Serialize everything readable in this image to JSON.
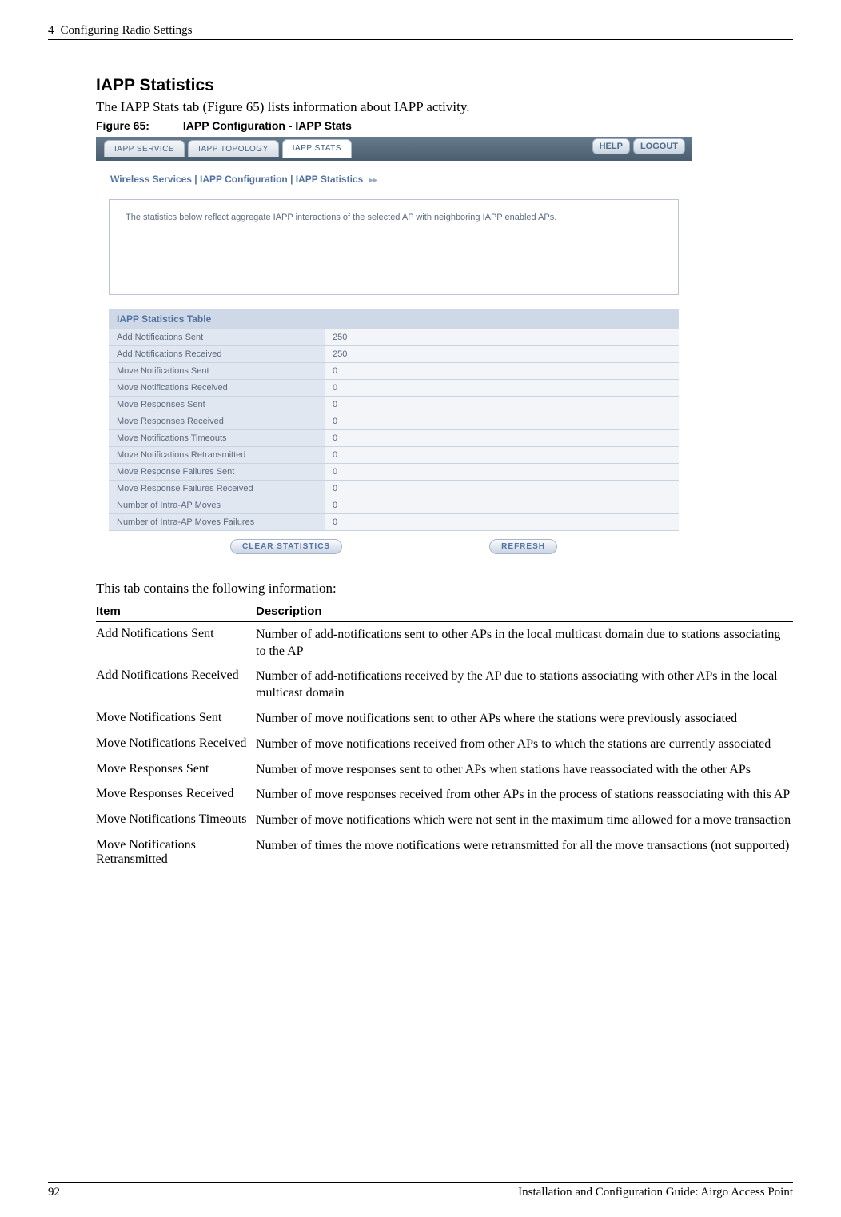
{
  "header": {
    "chapter_num": "4",
    "chapter_title": "Configuring Radio Settings"
  },
  "section": {
    "title": "IAPP Statistics",
    "intro": "The IAPP Stats tab (Figure 65) lists information about IAPP activity.",
    "figure_num": "Figure 65:",
    "figure_title": "IAPP Configuration - IAPP Stats",
    "after_figure": "This tab contains the following information:"
  },
  "screenshot": {
    "tabs": [
      "IAPP SERVICE",
      "IAPP TOPOLOGY",
      "IAPP STATS"
    ],
    "help": "HELP",
    "logout": "LOGOUT",
    "breadcrumb": "Wireless Services | IAPP Configuration | IAPP Statistics",
    "info_text": "The statistics below reflect aggregate IAPP interactions of the selected AP with neighboring IAPP enabled APs.",
    "table_title": "IAPP Statistics Table",
    "rows": [
      {
        "label": "Add Notifications Sent",
        "value": "250"
      },
      {
        "label": "Add Notifications Received",
        "value": "250"
      },
      {
        "label": "Move Notifications Sent",
        "value": "0"
      },
      {
        "label": "Move Notifications Received",
        "value": "0"
      },
      {
        "label": "Move Responses Sent",
        "value": "0"
      },
      {
        "label": "Move Responses Received",
        "value": "0"
      },
      {
        "label": "Move Notifications Timeouts",
        "value": "0"
      },
      {
        "label": "Move Notifications Retransmitted",
        "value": "0"
      },
      {
        "label": "Move Response Failures Sent",
        "value": "0"
      },
      {
        "label": "Move Response Failures Received",
        "value": "0"
      },
      {
        "label": "Number of Intra-AP Moves",
        "value": "0"
      },
      {
        "label": "Number of Intra-AP Moves Failures",
        "value": "0"
      }
    ],
    "btn_clear": "CLEAR STATISTICS",
    "btn_refresh": "REFRESH"
  },
  "desc_table": {
    "h_item": "Item",
    "h_desc": "Description",
    "rows": [
      {
        "item": "Add Notifications Sent",
        "desc": "Number of add-notifications sent to other APs in the local multicast domain due to stations associating to the AP"
      },
      {
        "item": "Add Notifications Received",
        "desc": "Number of add-notifications received by the AP due to stations associating with other APs in the local multicast domain"
      },
      {
        "item": "Move Notifications Sent",
        "desc": "Number of move notifications sent to other APs where the stations were previously associated"
      },
      {
        "item": "Move Notifications Received",
        "desc": "Number of move notifications received from other APs to which the stations are currently associated"
      },
      {
        "item": "Move Responses Sent",
        "desc": "Number of move responses sent to other APs when stations have reassociated with the other APs"
      },
      {
        "item": "Move Responses Received",
        "desc": "Number of move responses received from other APs in the process of stations reassociating with this AP"
      },
      {
        "item": "Move Notifications Timeouts",
        "desc": "Number of move notifications which were not sent in the maximum time allowed for a move transaction"
      },
      {
        "item": "Move Notifications Retransmitted",
        "desc": "Number of times the move notifications were retransmitted for all the move transactions (not supported)"
      }
    ]
  },
  "footer": {
    "page_num": "92",
    "doc_title": "Installation and Configuration Guide: Airgo Access Point"
  }
}
